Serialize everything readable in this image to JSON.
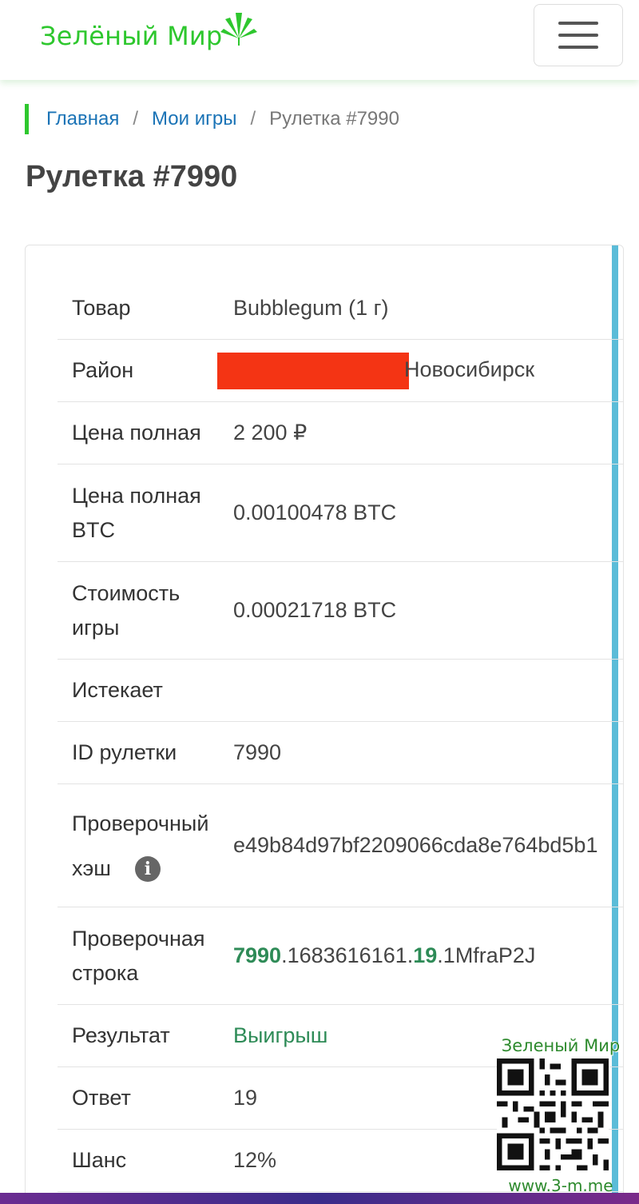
{
  "header": {
    "logo_text": "Зелёный Мир",
    "menu_icon": "hamburger-icon",
    "accent_color": "#2ec72e"
  },
  "breadcrumb": {
    "items": [
      "Главная",
      "Мои игры"
    ],
    "separator": "/",
    "current": "Рулетка #7990"
  },
  "page": {
    "title": "Рулетка #7990"
  },
  "details": {
    "rows": [
      {
        "label": "Товар",
        "value": "Bubblegum (1 г)"
      },
      {
        "label": "Район",
        "value": "Новосибирск"
      },
      {
        "label": "Цена полная",
        "value": "2 200 ₽"
      },
      {
        "label": "Цена полная BTC",
        "value": "0.00100478 BTC"
      },
      {
        "label": "Стоимость игры",
        "value": "0.00021718 BTC"
      },
      {
        "label": "Истекает",
        "value": ""
      },
      {
        "label": "ID рулетки",
        "value": "7990"
      },
      {
        "label": "Проверочный хэш",
        "value": "e49b84d97bf2209066cda8e764bd5b1"
      },
      {
        "label": "Проверочная строка",
        "value_parts": [
          "7990",
          ".1683616161.",
          "19",
          ".1MfraP2J"
        ]
      },
      {
        "label": "Результат",
        "value": "Выигрыш"
      },
      {
        "label": "Ответ",
        "value": "19"
      },
      {
        "label": "Шанс",
        "value": "12%"
      }
    ],
    "info_icon": "info-icon",
    "win_color": "#2e8b57"
  },
  "watermark": {
    "title": "Зеленый Мир",
    "url": "www.3-m.me"
  }
}
